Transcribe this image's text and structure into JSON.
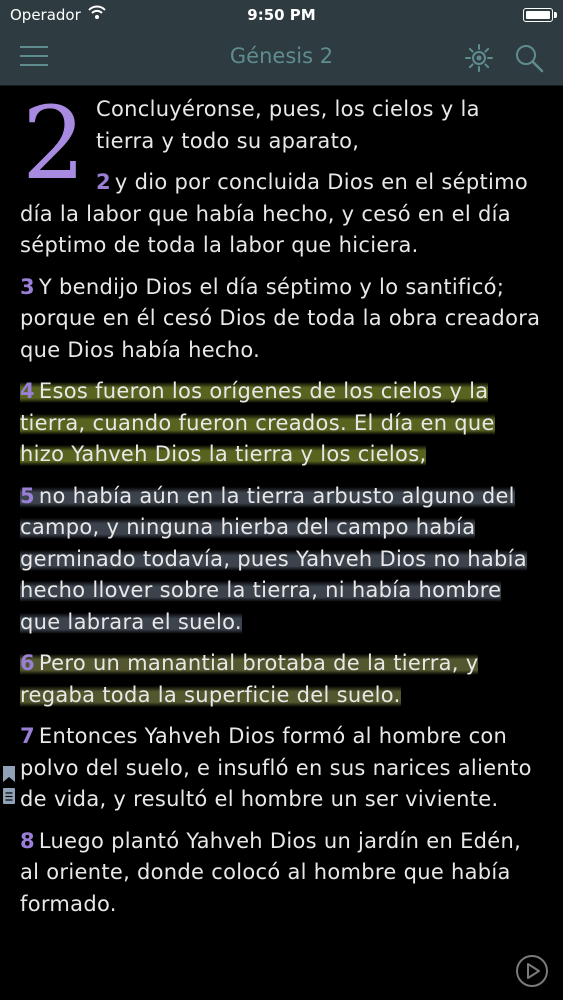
{
  "status_bar": {
    "carrier": "Operador",
    "time": "9:50 PM"
  },
  "nav": {
    "title": "Génesis 2"
  },
  "chapter": {
    "number": "2"
  },
  "verses": [
    {
      "num": "",
      "text": "Concluyéronse, pues, los cielos y la tierra y todo su aparato,"
    },
    {
      "num": "2",
      "text": "y dio por concluida Dios en el séptimo día la labor que había hecho, y cesó en el día séptimo de toda la labor que hiciera."
    },
    {
      "num": "3",
      "text": "Y bendijo Dios el día séptimo y lo santificó; porque en él cesó Dios de toda la obra creadora que Dios había hecho."
    },
    {
      "num": "4",
      "text": "Esos fueron los orígenes de los cielos y la tierra, cuando fueron creados. El día en que hizo Yahveh Dios la tierra y los cielos,",
      "highlight": "#8ca032"
    },
    {
      "num": "5",
      "text": "no había aún en la tierra arbusto alguno del campo, y ninguna hierba del campo había germinado todavía, pues Yahveh Dios no había hecho llover sobre la tierra, ni había hombre que labrara el suelo.",
      "highlight": "#6e7a8c"
    },
    {
      "num": "6",
      "text": "Pero un manantial brotaba de la tierra, y regaba toda la superficie del suelo.",
      "highlight": "#919650"
    },
    {
      "num": "7",
      "text": "Entonces Yahveh Dios formó al hombre con polvo del suelo, e insufló en sus narices aliento de vida, y resultó el hombre un ser viviente."
    },
    {
      "num": "8",
      "text": "Luego plantó Yahveh Dios un jardín en Edén, al oriente, donde colocó al hombre que había formado."
    }
  ],
  "colors": {
    "bar": "#2e3b40",
    "accent": "#5f8d8f",
    "verse_number": "#9a7fd6"
  },
  "icons": [
    "wifi-icon",
    "battery-icon",
    "menu-icon",
    "brightness-icon",
    "search-icon",
    "bookmark-icon",
    "play-icon"
  ]
}
